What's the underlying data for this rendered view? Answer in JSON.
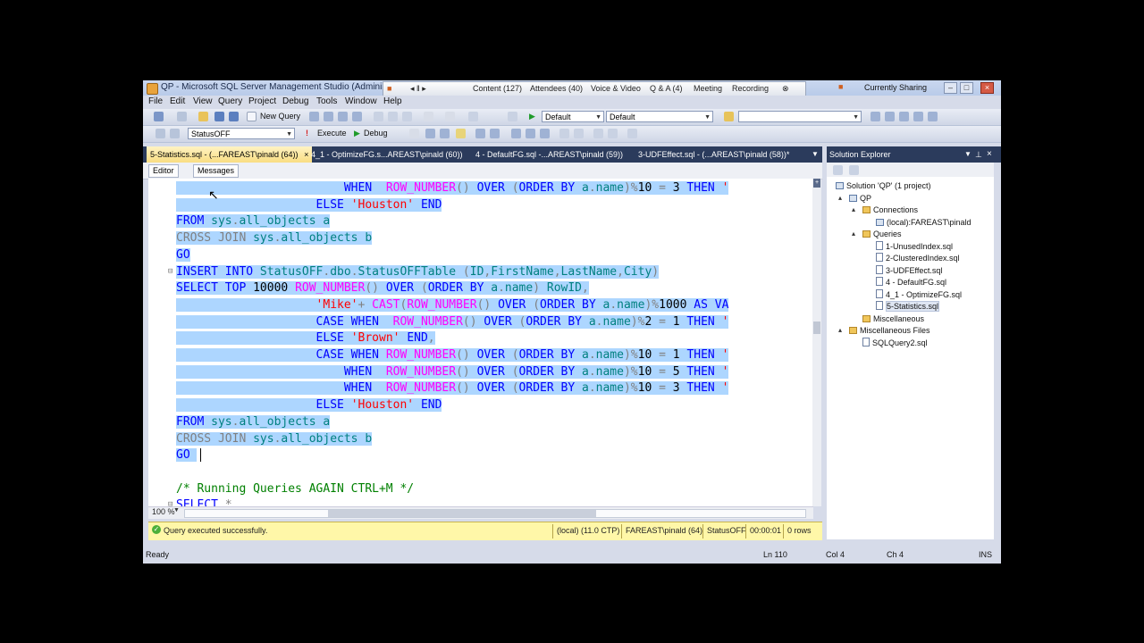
{
  "window": {
    "title": "QP - Microsoft SQL Server Management Studio (Administrator)"
  },
  "sharing_bar": {
    "items": [
      "Content (127)",
      "Attendees (40)",
      "Voice & Video",
      "Q & A (4)",
      "Meeting",
      "Recording"
    ],
    "currently_sharing": "Currently Sharing"
  },
  "menu": [
    "File",
    "Edit",
    "View",
    "Query",
    "Project",
    "Debug",
    "Tools",
    "Window",
    "Help"
  ],
  "toolbar1": {
    "new_query": "New Query",
    "combo_a": "Default",
    "combo_b": "Default"
  },
  "toolbar2": {
    "database": "StatusOFF",
    "execute": "Execute",
    "debug": "Debug"
  },
  "doc_tabs": [
    "5-Statistics.sql - (...FAREAST\\pinald (64))",
    "4_1 - OptimizeFG.s...AREAST\\pinald (60))",
    "4 - DefaultFG.sql -...AREAST\\pinald (59))",
    "3-UDFEffect.sql - (...AREAST\\pinald (58))*"
  ],
  "sub_tabs": {
    "editor": "Editor",
    "messages": "Messages"
  },
  "code_lines": [
    [
      {
        "t": "                        ",
        "c": "txt"
      },
      {
        "t": "WHEN  ",
        "c": "kw"
      },
      {
        "t": "ROW_NUMBER",
        "c": "fn"
      },
      {
        "t": "() ",
        "c": "gray"
      },
      {
        "t": "OVER ",
        "c": "kw"
      },
      {
        "t": "(",
        "c": "gray"
      },
      {
        "t": "ORDER BY ",
        "c": "kw"
      },
      {
        "t": "a",
        "c": "obj"
      },
      {
        "t": ".",
        "c": "gray"
      },
      {
        "t": "name",
        "c": "obj"
      },
      {
        "t": ")",
        "c": "gray"
      },
      {
        "t": "%",
        "c": "gray"
      },
      {
        "t": "10 ",
        "c": "txt"
      },
      {
        "t": "= ",
        "c": "gray"
      },
      {
        "t": "3 ",
        "c": "txt"
      },
      {
        "t": "THEN ",
        "c": "kw"
      },
      {
        "t": "'",
        "c": "str"
      }
    ],
    [
      {
        "t": "                    ",
        "c": "txt"
      },
      {
        "t": "ELSE ",
        "c": "kw"
      },
      {
        "t": "'Houston' ",
        "c": "str"
      },
      {
        "t": "END",
        "c": "kw"
      }
    ],
    [
      {
        "t": "FROM ",
        "c": "kw"
      },
      {
        "t": "sys",
        "c": "obj"
      },
      {
        "t": ".",
        "c": "gray"
      },
      {
        "t": "all_objects ",
        "c": "obj"
      },
      {
        "t": "a",
        "c": "obj"
      }
    ],
    [
      {
        "t": "CROSS JOIN ",
        "c": "gray"
      },
      {
        "t": "sys",
        "c": "obj"
      },
      {
        "t": ".",
        "c": "gray"
      },
      {
        "t": "all_objects ",
        "c": "obj"
      },
      {
        "t": "b",
        "c": "obj"
      }
    ],
    [
      {
        "t": "GO",
        "c": "kw"
      }
    ],
    [
      {
        "t": "INSERT INTO ",
        "c": "kw"
      },
      {
        "t": "StatusOFF",
        "c": "obj"
      },
      {
        "t": ".",
        "c": "gray"
      },
      {
        "t": "dbo",
        "c": "obj"
      },
      {
        "t": ".",
        "c": "gray"
      },
      {
        "t": "StatusOFFTable ",
        "c": "obj"
      },
      {
        "t": "(",
        "c": "gray"
      },
      {
        "t": "ID",
        "c": "obj"
      },
      {
        "t": ",",
        "c": "gray"
      },
      {
        "t": "FirstName",
        "c": "obj"
      },
      {
        "t": ",",
        "c": "gray"
      },
      {
        "t": "LastName",
        "c": "obj"
      },
      {
        "t": ",",
        "c": "gray"
      },
      {
        "t": "City",
        "c": "obj"
      },
      {
        "t": ")",
        "c": "gray"
      }
    ],
    [
      {
        "t": "SELECT TOP ",
        "c": "kw"
      },
      {
        "t": "10000 ",
        "c": "txt"
      },
      {
        "t": "ROW_NUMBER",
        "c": "fn"
      },
      {
        "t": "() ",
        "c": "gray"
      },
      {
        "t": "OVER ",
        "c": "kw"
      },
      {
        "t": "(",
        "c": "gray"
      },
      {
        "t": "ORDER BY ",
        "c": "kw"
      },
      {
        "t": "a",
        "c": "obj"
      },
      {
        "t": ".",
        "c": "gray"
      },
      {
        "t": "name",
        "c": "obj"
      },
      {
        "t": ") ",
        "c": "gray"
      },
      {
        "t": "RowID",
        "c": "obj"
      },
      {
        "t": ",",
        "c": "gray"
      }
    ],
    [
      {
        "t": "                    ",
        "c": "txt"
      },
      {
        "t": "'Mike'",
        "c": "str"
      },
      {
        "t": "+ ",
        "c": "gray"
      },
      {
        "t": "CAST",
        "c": "fn"
      },
      {
        "t": "(",
        "c": "gray"
      },
      {
        "t": "ROW_NUMBER",
        "c": "fn"
      },
      {
        "t": "() ",
        "c": "gray"
      },
      {
        "t": "OVER ",
        "c": "kw"
      },
      {
        "t": "(",
        "c": "gray"
      },
      {
        "t": "ORDER BY ",
        "c": "kw"
      },
      {
        "t": "a",
        "c": "obj"
      },
      {
        "t": ".",
        "c": "gray"
      },
      {
        "t": "name",
        "c": "obj"
      },
      {
        "t": ")",
        "c": "gray"
      },
      {
        "t": "%",
        "c": "gray"
      },
      {
        "t": "1000 ",
        "c": "txt"
      },
      {
        "t": "AS VA",
        "c": "kw"
      }
    ],
    [
      {
        "t": "                    ",
        "c": "txt"
      },
      {
        "t": "CASE WHEN  ",
        "c": "kw"
      },
      {
        "t": "ROW_NUMBER",
        "c": "fn"
      },
      {
        "t": "() ",
        "c": "gray"
      },
      {
        "t": "OVER ",
        "c": "kw"
      },
      {
        "t": "(",
        "c": "gray"
      },
      {
        "t": "ORDER BY ",
        "c": "kw"
      },
      {
        "t": "a",
        "c": "obj"
      },
      {
        "t": ".",
        "c": "gray"
      },
      {
        "t": "name",
        "c": "obj"
      },
      {
        "t": ")",
        "c": "gray"
      },
      {
        "t": "%",
        "c": "gray"
      },
      {
        "t": "2 ",
        "c": "txt"
      },
      {
        "t": "= ",
        "c": "gray"
      },
      {
        "t": "1 ",
        "c": "txt"
      },
      {
        "t": "THEN ",
        "c": "kw"
      },
      {
        "t": "'",
        "c": "str"
      }
    ],
    [
      {
        "t": "                    ",
        "c": "txt"
      },
      {
        "t": "ELSE ",
        "c": "kw"
      },
      {
        "t": "'Brown' ",
        "c": "str"
      },
      {
        "t": "END",
        "c": "kw"
      },
      {
        "t": ",",
        "c": "gray"
      }
    ],
    [
      {
        "t": "                    ",
        "c": "txt"
      },
      {
        "t": "CASE WHEN ",
        "c": "kw"
      },
      {
        "t": "ROW_NUMBER",
        "c": "fn"
      },
      {
        "t": "() ",
        "c": "gray"
      },
      {
        "t": "OVER ",
        "c": "kw"
      },
      {
        "t": "(",
        "c": "gray"
      },
      {
        "t": "ORDER BY ",
        "c": "kw"
      },
      {
        "t": "a",
        "c": "obj"
      },
      {
        "t": ".",
        "c": "gray"
      },
      {
        "t": "name",
        "c": "obj"
      },
      {
        "t": ")",
        "c": "gray"
      },
      {
        "t": "%",
        "c": "gray"
      },
      {
        "t": "10 ",
        "c": "txt"
      },
      {
        "t": "= ",
        "c": "gray"
      },
      {
        "t": "1 ",
        "c": "txt"
      },
      {
        "t": "THEN ",
        "c": "kw"
      },
      {
        "t": "'",
        "c": "str"
      }
    ],
    [
      {
        "t": "                        ",
        "c": "txt"
      },
      {
        "t": "WHEN  ",
        "c": "kw"
      },
      {
        "t": "ROW_NUMBER",
        "c": "fn"
      },
      {
        "t": "() ",
        "c": "gray"
      },
      {
        "t": "OVER ",
        "c": "kw"
      },
      {
        "t": "(",
        "c": "gray"
      },
      {
        "t": "ORDER BY ",
        "c": "kw"
      },
      {
        "t": "a",
        "c": "obj"
      },
      {
        "t": ".",
        "c": "gray"
      },
      {
        "t": "name",
        "c": "obj"
      },
      {
        "t": ")",
        "c": "gray"
      },
      {
        "t": "%",
        "c": "gray"
      },
      {
        "t": "10 ",
        "c": "txt"
      },
      {
        "t": "= ",
        "c": "gray"
      },
      {
        "t": "5 ",
        "c": "txt"
      },
      {
        "t": "THEN ",
        "c": "kw"
      },
      {
        "t": "'",
        "c": "str"
      }
    ],
    [
      {
        "t": "                        ",
        "c": "txt"
      },
      {
        "t": "WHEN  ",
        "c": "kw"
      },
      {
        "t": "ROW_NUMBER",
        "c": "fn"
      },
      {
        "t": "() ",
        "c": "gray"
      },
      {
        "t": "OVER ",
        "c": "kw"
      },
      {
        "t": "(",
        "c": "gray"
      },
      {
        "t": "ORDER BY ",
        "c": "kw"
      },
      {
        "t": "a",
        "c": "obj"
      },
      {
        "t": ".",
        "c": "gray"
      },
      {
        "t": "name",
        "c": "obj"
      },
      {
        "t": ")",
        "c": "gray"
      },
      {
        "t": "%",
        "c": "gray"
      },
      {
        "t": "10 ",
        "c": "txt"
      },
      {
        "t": "= ",
        "c": "gray"
      },
      {
        "t": "3 ",
        "c": "txt"
      },
      {
        "t": "THEN ",
        "c": "kw"
      },
      {
        "t": "'",
        "c": "str"
      }
    ],
    [
      {
        "t": "                    ",
        "c": "txt"
      },
      {
        "t": "ELSE ",
        "c": "kw"
      },
      {
        "t": "'Houston' ",
        "c": "str"
      },
      {
        "t": "END",
        "c": "kw"
      }
    ],
    [
      {
        "t": "FROM ",
        "c": "kw"
      },
      {
        "t": "sys",
        "c": "obj"
      },
      {
        "t": ".",
        "c": "gray"
      },
      {
        "t": "all_objects ",
        "c": "obj"
      },
      {
        "t": "a",
        "c": "obj"
      }
    ],
    [
      {
        "t": "CROSS JOIN ",
        "c": "gray"
      },
      {
        "t": "sys",
        "c": "obj"
      },
      {
        "t": ".",
        "c": "gray"
      },
      {
        "t": "all_objects ",
        "c": "obj"
      },
      {
        "t": "b",
        "c": "obj"
      }
    ],
    [
      {
        "t": "GO",
        "c": "kw"
      },
      {
        "t": " ",
        "c": "txt"
      }
    ],
    [
      {
        "t": "",
        "c": "txt"
      }
    ],
    [
      {
        "t": "/* Running Queries AGAIN CTRL+M */",
        "c": "cmt"
      }
    ],
    [
      {
        "t": "SELECT ",
        "c": "kw"
      },
      {
        "t": "*",
        "c": "gray"
      }
    ]
  ],
  "zoom": "100 %",
  "query_status": {
    "message": "Query executed successfully.",
    "server": "(local) (11.0 CTP)",
    "user": "FAREAST\\pinald (64)",
    "database": "StatusOFF",
    "elapsed": "00:00:01",
    "rows": "0 rows"
  },
  "solution_explorer": {
    "title": "Solution Explorer",
    "tree": [
      {
        "label": "Solution 'QP' (1 project)",
        "depth": 0,
        "icon": "solution-icon",
        "arrow": ""
      },
      {
        "label": "QP",
        "depth": 1,
        "icon": "project-icon",
        "arrow": "▴"
      },
      {
        "label": "Connections",
        "depth": 2,
        "icon": "folder-icon",
        "arrow": "▴"
      },
      {
        "label": "(local):FAREAST\\pinald",
        "depth": 3,
        "icon": "server-icon",
        "arrow": ""
      },
      {
        "label": "Queries",
        "depth": 2,
        "icon": "folder-icon",
        "arrow": "▴"
      },
      {
        "label": "1-UnusedIndex.sql",
        "depth": 3,
        "icon": "sql-file-icon",
        "arrow": ""
      },
      {
        "label": "2-ClusteredIndex.sql",
        "depth": 3,
        "icon": "sql-file-icon",
        "arrow": ""
      },
      {
        "label": "3-UDFEffect.sql",
        "depth": 3,
        "icon": "sql-file-icon",
        "arrow": ""
      },
      {
        "label": "4 - DefaultFG.sql",
        "depth": 3,
        "icon": "sql-file-icon",
        "arrow": ""
      },
      {
        "label": "4_1 - OptimizeFG.sql",
        "depth": 3,
        "icon": "sql-file-icon",
        "arrow": ""
      },
      {
        "label": "5-Statistics.sql",
        "depth": 3,
        "icon": "sql-file-icon",
        "arrow": "",
        "selected": true
      },
      {
        "label": "Miscellaneous",
        "depth": 2,
        "icon": "folder-icon",
        "arrow": ""
      },
      {
        "label": "Miscellaneous Files",
        "depth": 1,
        "icon": "folder-icon",
        "arrow": "▴"
      },
      {
        "label": "SQLQuery2.sql",
        "depth": 2,
        "icon": "sql-file-icon",
        "arrow": ""
      }
    ]
  },
  "status_bar": {
    "ready": "Ready",
    "ln": "Ln 110",
    "col": "Col 4",
    "ch": "Ch 4",
    "mode": "INS"
  }
}
